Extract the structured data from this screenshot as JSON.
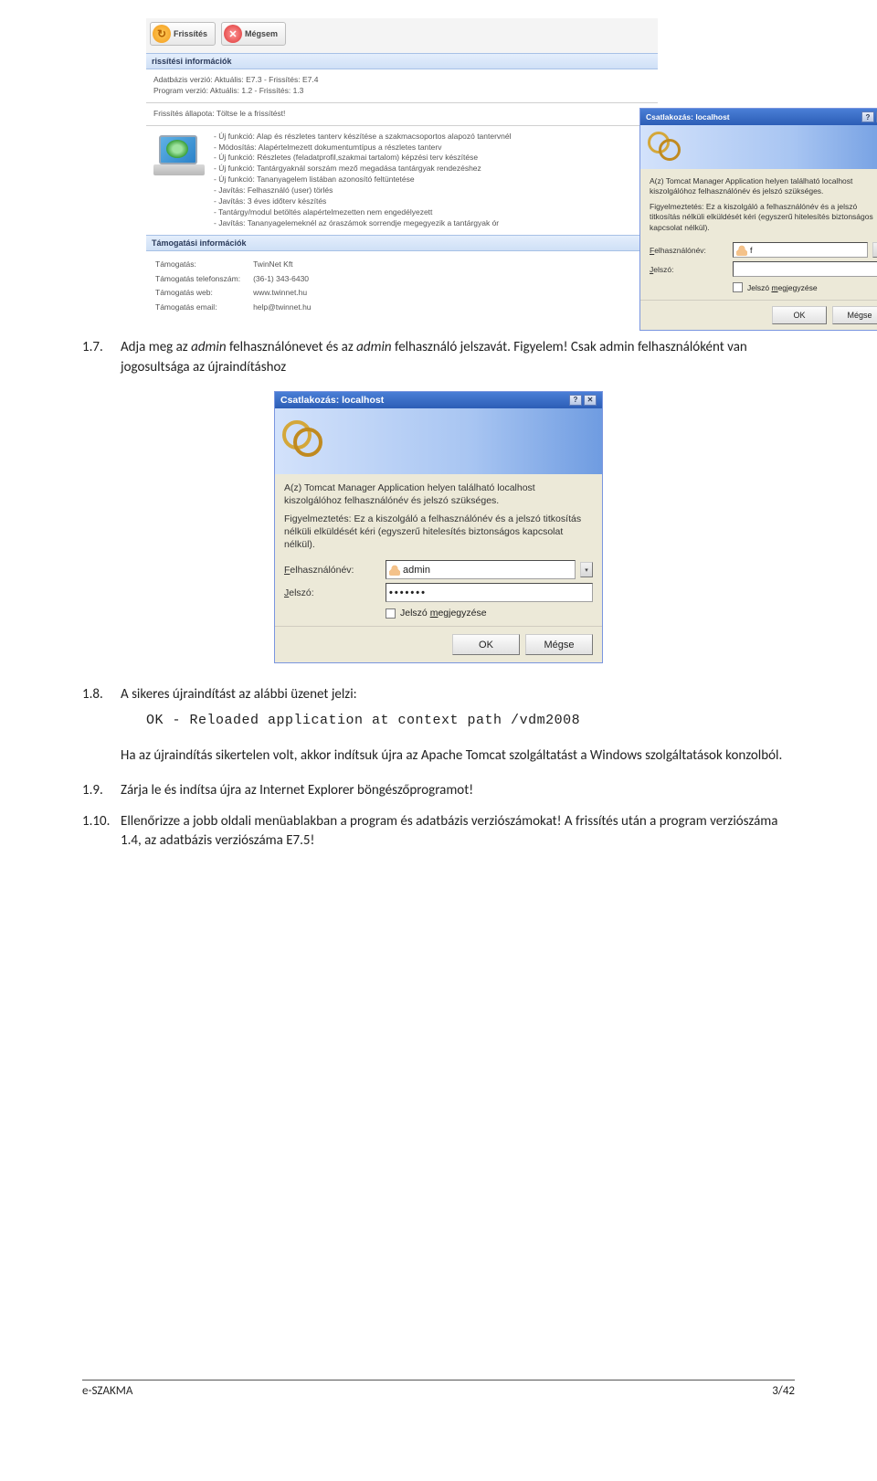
{
  "updater": {
    "toolbar": {
      "refresh": "Frissítés",
      "cancel": "Mégsem"
    },
    "section_update_info": "rissítési információk",
    "db_line": "Adatbázis verzió:  Aktuális: E7.3 - Frissítés: E7.4",
    "prog_line": "Program verzió:    Aktuális: 1.2  - Frissítés: 1.3",
    "status_title": "Frissítés állapota: Töltse le a frissítést!",
    "changes": [
      "- Új funkció: Alap és részletes tanterv készítése a szakmacsoportos alapozó tantervnél",
      "- Módosítás: Alapértelmezett dokumentumtípus a részletes tanterv",
      "- Új funkció: Részletes (feladatprofil,szakmai tartalom) képzési terv készítése",
      "- Új funkció: Tantárgyaknál sorszám mező megadása tantárgyak rendezéshez",
      "- Új funkció: Tananyagelem listában azonosító feltüntetése",
      "- Javítás: Felhasználó (user) törlés",
      "- Javítás: 3 éves időterv készítés",
      "- Tantárgy/modul betöltés alapértelmezetten nem engedélyezett",
      "- Javítás: Tananyagelemeknél az óraszámok sorrendje megegyezik a tantárgyak ór"
    ],
    "section_support": "Támogatási információk",
    "support_rows": [
      [
        "Támogatás:",
        "TwinNet Kft"
      ],
      [
        "Támogatás telefonszám:",
        "(36-1) 343-6430"
      ],
      [
        "Támogatás web:",
        "www.twinnet.hu"
      ],
      [
        "Támogatás email:",
        "help@twinnet.hu"
      ]
    ]
  },
  "auth": {
    "title": "Csatlakozás: localhost",
    "text1": "A(z) Tomcat Manager Application helyen található localhost kiszolgálóhoz felhasználónév és jelszó szükséges.",
    "text2": "Figyelmeztetés: Ez a kiszolgáló a felhasználónév és a jelszó titkosítás nélküli elküldését kéri (egyszerű hitelesítés biztonságos kapcsolat nélkül).",
    "label_user": "Felhasználónév:",
    "label_pass": "Jelszó:",
    "user_small": "f",
    "user_big": "admin",
    "pass_big": "•••••••",
    "remember": "Jelszó megjegyzése",
    "ok": "OK",
    "cancel": "Mégse"
  },
  "body": {
    "i17_num": "1.7.",
    "i17_a": "Adja meg az ",
    "i17_em1": "admin",
    "i17_b": " felhasználónevet és az ",
    "i17_em2": "admin",
    "i17_c": " felhasználó jelszavát. Figyelem! Csak admin felhasználóként van jogosultsága az újraindításhoz",
    "i18_num": "1.8.",
    "i18": "A sikeres újraindítást az alábbi üzenet jelzi:",
    "ok_line": "OK - Reloaded application at context path /vdm2008",
    "restart_note": "Ha az újraindítás sikertelen volt, akkor indítsuk újra az Apache Tomcat szolgáltatást a Windows szolgáltatások konzolból.",
    "i19_num": "1.9.",
    "i19": "Zárja le és indítsa újra az Internet Explorer böngészőprogramot!",
    "i110_num": "1.10.",
    "i110": "Ellenőrizze a jobb oldali menüablakban a program és adatbázis verziószámokat! A frissítés után a program verziószáma 1.4, az adatbázis verziószáma E7.5!"
  },
  "footer": {
    "left": "e-SZAKMA",
    "right": "3/42"
  }
}
